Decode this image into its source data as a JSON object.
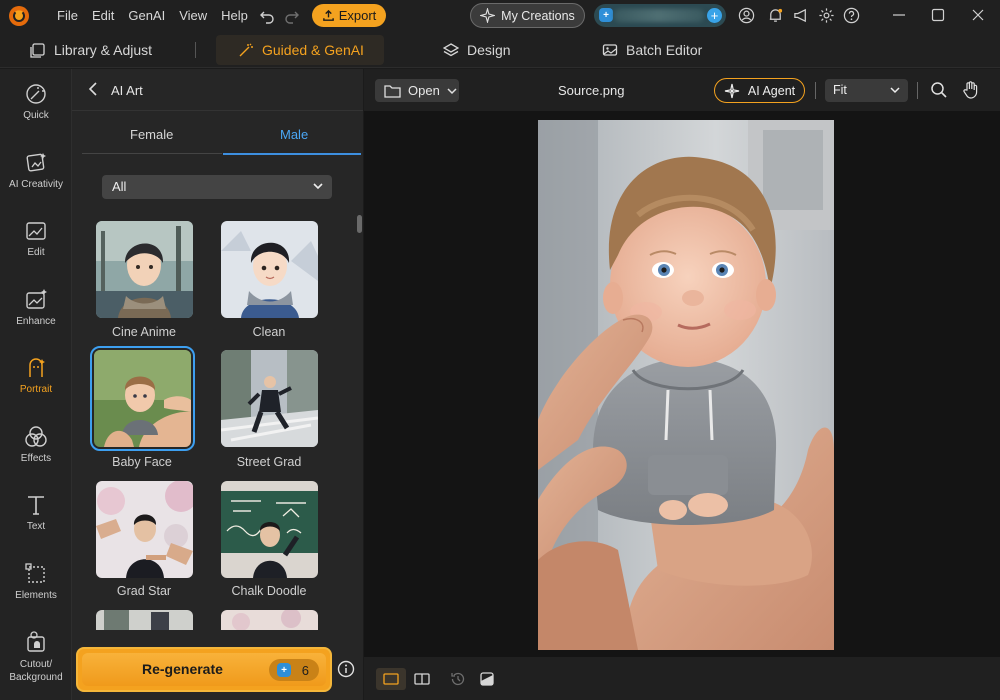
{
  "titlebar": {
    "menu": [
      "File",
      "Edit",
      "GenAI",
      "View",
      "Help"
    ],
    "export_label": "Export",
    "creations_label": "My Creations"
  },
  "tabs": [
    {
      "label": "Library & Adjust",
      "icon": "library-icon"
    },
    {
      "label": "Guided & GenAI",
      "icon": "magic-wand-icon",
      "active": true
    },
    {
      "label": "Design",
      "icon": "layers-icon"
    },
    {
      "label": "Batch Editor",
      "icon": "batch-images-icon"
    }
  ],
  "sidebar": {
    "items": [
      {
        "label": "Quick",
        "icon": "magic-wand-icon"
      },
      {
        "label": "AI Creativity",
        "icon": "ai-creativity-icon"
      },
      {
        "label": "Edit",
        "icon": "edit-image-icon"
      },
      {
        "label": "Enhance",
        "icon": "enhance-image-icon"
      },
      {
        "label": "Portrait",
        "icon": "portrait-icon",
        "active": true
      },
      {
        "label": "Effects",
        "icon": "effects-icon"
      },
      {
        "label": "Text",
        "icon": "text-icon"
      },
      {
        "label": "Elements",
        "icon": "elements-icon"
      },
      {
        "label": "Cutout/",
        "label2": "Background",
        "icon": "cutout-icon"
      }
    ]
  },
  "panel": {
    "title": "AI Art",
    "segments": [
      "Female",
      "Male"
    ],
    "active_segment": "Male",
    "filter_value": "All",
    "styles": [
      {
        "label": "Cine Anime"
      },
      {
        "label": "Clean"
      },
      {
        "label": "Baby Face",
        "selected": true
      },
      {
        "label": "Street Grad"
      },
      {
        "label": "Grad Star"
      },
      {
        "label": "Chalk Doodle"
      }
    ],
    "regenerate_label": "Re-generate",
    "credits": "6"
  },
  "canvas": {
    "open_label": "Open",
    "filename": "Source.png",
    "agent_label": "AI Agent",
    "zoom_value": "Fit"
  },
  "colors": {
    "accent": "#f4a21f",
    "selection": "#3d9ff0",
    "background": "#1b1b1b"
  }
}
